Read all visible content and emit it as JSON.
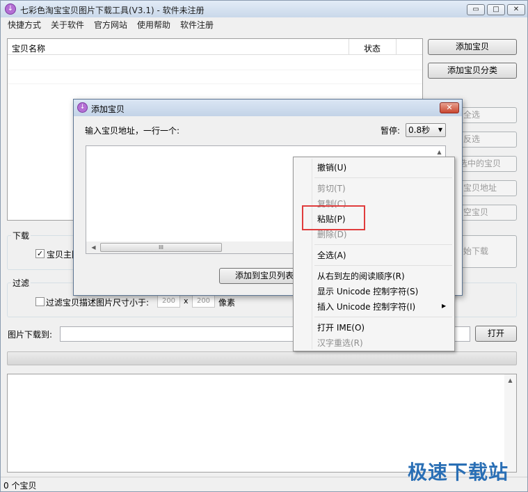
{
  "window": {
    "title": "七彩色淘宝宝贝图片下载工具(V3.1) - 软件未注册",
    "minimize": "▭",
    "maximize": "□",
    "close": "✕",
    "icon": "download-circle-icon"
  },
  "menu": [
    "快捷方式",
    "关于软件",
    "官方网站",
    "使用帮助",
    "软件注册"
  ],
  "list": {
    "col_name": "宝贝名称",
    "col_status": "状态"
  },
  "right_buttons": {
    "add": "添加宝贝",
    "add_category": "添加宝贝分类",
    "select_all": "全选",
    "invert": "反选",
    "delete_selected": "选中的宝贝",
    "copy_url": "宝贝地址",
    "clear": "空宝贝",
    "start": "始下载"
  },
  "download_group": {
    "label": "下载",
    "main_image_checkbox": "宝贝主图",
    "checked": true
  },
  "filter_group": {
    "label": "过滤",
    "checkbox_label": "过滤宝贝描述图片尺寸小于:",
    "width": "200",
    "x": "x",
    "height": "200",
    "unit": "像素"
  },
  "save_to": {
    "label": "图片下载到:",
    "open": "打开"
  },
  "status": {
    "count": "0 个宝贝"
  },
  "watermark": "极速下载站",
  "dialog": {
    "title": "添加宝贝",
    "prompt": "输入宝贝地址，一行一个:",
    "pause_label": "暂停:",
    "pause_value": "0.8秒",
    "submit": "添加到宝贝列表",
    "close": "✕",
    "scroll_grip": "III"
  },
  "context_menu": {
    "items": [
      {
        "label": "撤销(U)",
        "enabled": true
      },
      {
        "label": "剪切(T)",
        "enabled": false
      },
      {
        "label": "复制(C)",
        "enabled": false
      },
      {
        "label": "粘贴(P)",
        "enabled": true
      },
      {
        "label": "删除(D)",
        "enabled": false
      },
      {
        "label": "全选(A)",
        "enabled": true
      },
      {
        "label": "从右到左的阅读顺序(R)",
        "enabled": true
      },
      {
        "label": "显示 Unicode 控制字符(S)",
        "enabled": true
      },
      {
        "label": "插入 Unicode 控制字符(I)",
        "enabled": true
      },
      {
        "label": "打开 IME(O)",
        "enabled": true
      },
      {
        "label": "汉字重选(R)",
        "enabled": false
      }
    ],
    "submenu_arrow": "▶"
  },
  "colors": {
    "highlight": "#e03c3c",
    "watermark": "#2a6fb5"
  }
}
